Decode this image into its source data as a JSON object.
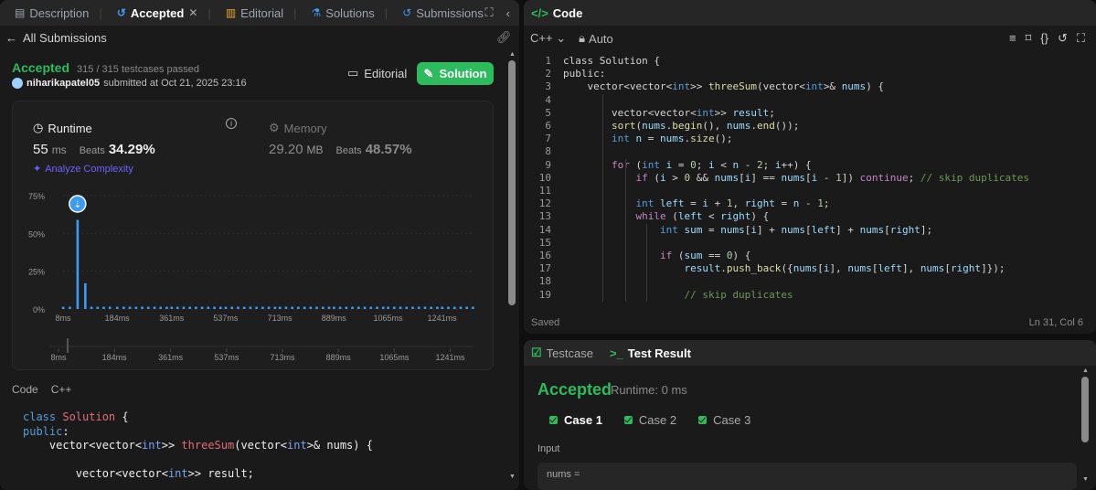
{
  "left_tabs": [
    {
      "label": "Description",
      "icon": "document-icon"
    },
    {
      "label": "Accepted",
      "icon": "history-icon",
      "active": true
    },
    {
      "label": "Editorial",
      "icon": "book-icon"
    },
    {
      "label": "Solutions",
      "icon": "flask-icon"
    },
    {
      "label": "Submissions",
      "icon": "history-icon"
    }
  ],
  "tab_close": "✕",
  "nav": {
    "back_label": "All Submissions"
  },
  "submission": {
    "status": "Accepted",
    "testcases": "315 / 315 testcases passed",
    "username": "niharikapatel05",
    "submitted_at": "submitted at Oct 21, 2025 23:16",
    "editorial_button": "Editorial",
    "solution_button": "Solution"
  },
  "runtime": {
    "label": "Runtime",
    "value": "55",
    "unit": "ms",
    "beats_label": "Beats",
    "beats_pct": "34.29%",
    "analyze": "Analyze Complexity"
  },
  "memory": {
    "label": "Memory",
    "value": "29.20",
    "unit": "MB",
    "beats_label": "Beats",
    "beats_pct": "48.57%"
  },
  "chart_data": {
    "type": "bar",
    "title": "",
    "ylabel": "",
    "xlabel": "",
    "y_ticks": [
      "75%",
      "50%",
      "25%",
      "0%"
    ],
    "ylim": [
      0,
      75
    ],
    "x_ticks": [
      "8ms",
      "184ms",
      "361ms",
      "537ms",
      "713ms",
      "889ms",
      "1065ms",
      "1241ms"
    ],
    "xlim": [
      8,
      1346
    ],
    "bar_color": "#3b9bf5",
    "marker_at_ms": 55,
    "bars": [
      {
        "ms": 8,
        "pct": 1.5
      },
      {
        "ms": 30,
        "pct": 1.5
      },
      {
        "ms": 55,
        "pct": 59
      },
      {
        "ms": 80,
        "pct": 17
      },
      {
        "ms": 100,
        "pct": 1.5
      },
      {
        "ms": 120,
        "pct": 1.5
      },
      {
        "ms": 140,
        "pct": 1.5
      },
      {
        "ms": 160,
        "pct": 1.5
      },
      {
        "ms": 184,
        "pct": 1.5
      },
      {
        "ms": 205,
        "pct": 1.5
      },
      {
        "ms": 225,
        "pct": 1.5
      },
      {
        "ms": 245,
        "pct": 1.5
      },
      {
        "ms": 265,
        "pct": 1.5
      },
      {
        "ms": 285,
        "pct": 1.5
      },
      {
        "ms": 305,
        "pct": 1.5
      },
      {
        "ms": 325,
        "pct": 1.5
      },
      {
        "ms": 345,
        "pct": 1.5
      },
      {
        "ms": 361,
        "pct": 1.5
      },
      {
        "ms": 380,
        "pct": 1.5
      },
      {
        "ms": 400,
        "pct": 1.5
      },
      {
        "ms": 420,
        "pct": 1.5
      },
      {
        "ms": 440,
        "pct": 1.5
      },
      {
        "ms": 460,
        "pct": 1.5
      },
      {
        "ms": 480,
        "pct": 1.5
      },
      {
        "ms": 500,
        "pct": 1.5
      },
      {
        "ms": 520,
        "pct": 1.5
      },
      {
        "ms": 537,
        "pct": 1.5
      },
      {
        "ms": 557,
        "pct": 1.5
      },
      {
        "ms": 577,
        "pct": 1.5
      },
      {
        "ms": 597,
        "pct": 1.5
      },
      {
        "ms": 617,
        "pct": 1.5
      },
      {
        "ms": 637,
        "pct": 1.5
      },
      {
        "ms": 657,
        "pct": 1.5
      },
      {
        "ms": 677,
        "pct": 1.5
      },
      {
        "ms": 697,
        "pct": 1.5
      },
      {
        "ms": 713,
        "pct": 1.5
      },
      {
        "ms": 733,
        "pct": 1.5
      },
      {
        "ms": 753,
        "pct": 1.5
      },
      {
        "ms": 773,
        "pct": 1.5
      },
      {
        "ms": 793,
        "pct": 1.5
      },
      {
        "ms": 813,
        "pct": 1.5
      },
      {
        "ms": 833,
        "pct": 1.5
      },
      {
        "ms": 853,
        "pct": 1.5
      },
      {
        "ms": 873,
        "pct": 1.5
      },
      {
        "ms": 889,
        "pct": 1.5
      },
      {
        "ms": 909,
        "pct": 1.5
      },
      {
        "ms": 929,
        "pct": 1.5
      },
      {
        "ms": 949,
        "pct": 1.5
      },
      {
        "ms": 969,
        "pct": 1.5
      },
      {
        "ms": 989,
        "pct": 1.5
      },
      {
        "ms": 1009,
        "pct": 1.5
      },
      {
        "ms": 1029,
        "pct": 1.5
      },
      {
        "ms": 1049,
        "pct": 1.5
      },
      {
        "ms": 1065,
        "pct": 1.5
      },
      {
        "ms": 1085,
        "pct": 1.5
      },
      {
        "ms": 1105,
        "pct": 1.5
      },
      {
        "ms": 1125,
        "pct": 1.5
      },
      {
        "ms": 1145,
        "pct": 1.5
      },
      {
        "ms": 1165,
        "pct": 1.5
      },
      {
        "ms": 1185,
        "pct": 1.5
      },
      {
        "ms": 1205,
        "pct": 1.5
      },
      {
        "ms": 1225,
        "pct": 1.5
      },
      {
        "ms": 1241,
        "pct": 1.5
      },
      {
        "ms": 1261,
        "pct": 1.5
      },
      {
        "ms": 1281,
        "pct": 1.5
      },
      {
        "ms": 1301,
        "pct": 1.5
      },
      {
        "ms": 1321,
        "pct": 1.5
      },
      {
        "ms": 1341,
        "pct": 1.5
      }
    ]
  },
  "left_code": {
    "header": "Code",
    "lang": "C++",
    "lines": [
      "class Solution {",
      "public:",
      "    vector<vector<int>> threeSum(vector<int>& nums) {",
      "",
      "        vector<vector<int>> result;"
    ]
  },
  "code_panel": {
    "title": "Code",
    "lang": "C++",
    "auto": "Auto",
    "saved": "Saved",
    "cursor": "Ln 31, Col 6",
    "lines": [
      "class Solution {",
      "public:",
      "    vector<vector<int>> threeSum(vector<int>& nums) {",
      "",
      "        vector<vector<int>> result;",
      "        sort(nums.begin(), nums.end());",
      "        int n = nums.size();",
      "",
      "        for (int i = 0; i < n - 2; i++) {",
      "            if (i > 0 && nums[i] == nums[i - 1]) continue; // skip duplicates",
      "",
      "            int left = i + 1, right = n - 1;",
      "            while (left < right) {",
      "                int sum = nums[i] + nums[left] + nums[right];",
      "",
      "                if (sum == 0) {",
      "                    result.push_back({nums[i], nums[left], nums[right]});",
      "",
      "                    // skip duplicates"
    ]
  },
  "test_panel": {
    "tab_testcase": "Testcase",
    "tab_result": "Test Result",
    "status": "Accepted",
    "runtime": "Runtime: 0 ms",
    "cases": [
      "Case 1",
      "Case 2",
      "Case 3"
    ],
    "input_label": "Input",
    "nums_label": "nums ="
  },
  "colors": {
    "accent_green": "#2cbb5d",
    "bar_blue": "#3b9bf5",
    "purple": "#6c63ff"
  }
}
